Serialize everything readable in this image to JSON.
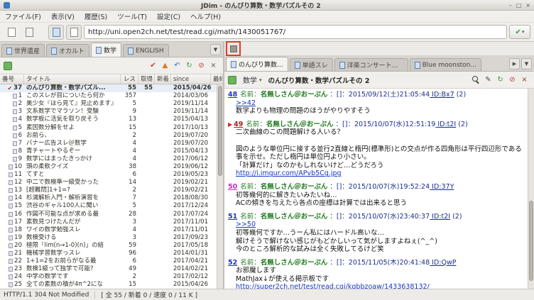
{
  "window": {
    "title": "JDim - のんびり算数・数学パズルその 2",
    "controls": {
      "minimize": "–",
      "maximize": "□",
      "close": "×"
    }
  },
  "icons": {
    "dropdown": "▼",
    "dropdown_small": "▾",
    "tab_next": "▶",
    "check_green": "✔",
    "bookmark": "▶"
  },
  "menubar": [
    "ファイル(F)",
    "表示(V)",
    "履歴(S)",
    "ツール(T)",
    "設定(C)",
    "ヘルプ(H)"
  ],
  "toolbar": {
    "url": "http://uni.open2ch.net/test/read.cgi/math/1430051767/"
  },
  "board_pane": {
    "tabs": [
      {
        "label": "世界遺産",
        "active": false
      },
      {
        "label": "オカルト",
        "active": false
      },
      {
        "label": "数学",
        "active": true
      },
      {
        "label": "ENGLISH",
        "active": false
      }
    ],
    "toolbar_buttons": [
      {
        "name": "check-update-icon",
        "glyph": "✔",
        "color": "#c43c3c"
      },
      {
        "name": "scroll-up-icon",
        "glyph": "▲",
        "color": "#e07820"
      },
      {
        "name": "back-icon",
        "glyph": "↶",
        "color": "#3a6fc4"
      },
      {
        "name": "reload-icon",
        "glyph": "↻",
        "color": "#3a9a3a"
      },
      {
        "name": "stop-icon",
        "glyph": "⊘",
        "color": "#c43c3c"
      },
      {
        "name": "close-icon",
        "glyph": "×",
        "color": "#555555"
      }
    ],
    "columns": [
      "番号",
      "タイトル",
      "レス",
      "取得",
      "新着",
      "since",
      "最終書込"
    ],
    "rows": [
      {
        "check": true,
        "selected": true,
        "num": "37",
        "title": "のんびり算数・数学パズル...",
        "res": "55",
        "got": "55",
        "new": "",
        "since": "2015/04/26"
      },
      {
        "num": "1",
        "title": "このスレが目についたら何か",
        "res": "357",
        "since": "2014/03/06"
      },
      {
        "num": "2",
        "title": "美少女『ほら見て』見止めます』",
        "res": "5",
        "since": "2019/11/14"
      },
      {
        "num": "3",
        "title": "文系数学でマラソン！受験",
        "res": "9",
        "since": "2019/11/14"
      },
      {
        "num": "4",
        "title": "数学板に活気を取り戻そう",
        "res": "13",
        "since": "2015/04/13"
      },
      {
        "num": "5",
        "title": "素因数分解をせよ",
        "res": "15",
        "since": "2017/10/13"
      },
      {
        "num": "6",
        "title": "お前ら、",
        "res": "2",
        "since": "2019/07/20"
      },
      {
        "num": "7",
        "title": "バナー広告スレ＠数学",
        "res": "4",
        "since": "2019/07/20"
      },
      {
        "num": "8",
        "title": "青チャートやるぞー",
        "res": "4",
        "since": "2015/04/13"
      },
      {
        "num": "9",
        "title": "数学にはまったきっかけ",
        "res": "4",
        "since": "2017/06/12"
      },
      {
        "num": "10",
        "title": "頭の柔軟クイズ",
        "res": "38",
        "since": "2019/06/12"
      },
      {
        "num": "11",
        "title": "てすと",
        "res": "6",
        "since": "2019/05/23"
      },
      {
        "num": "12",
        "title": "中二で数検準一級受かった",
        "res": "14",
        "since": "2019/02/21"
      },
      {
        "num": "13",
        "title": "[超難問]1+1=?",
        "res": "2",
        "since": "2019/02/21"
      },
      {
        "num": "14",
        "title": "杉浦解析入門・解析演習を",
        "res": "7",
        "since": "2018/08/30"
      },
      {
        "num": "15",
        "title": "渋谷のギャル100人に聞い",
        "res": "5",
        "since": "2017/12/24"
      },
      {
        "num": "16",
        "title": "作図不可能な点が求める最",
        "res": "28",
        "since": "2017/07/24"
      },
      {
        "num": "17",
        "title": "素数見つけたんだが",
        "res": "3",
        "since": "2017/11/01"
      },
      {
        "num": "18",
        "title": "ワイの数学勉強スレ",
        "res": "4",
        "since": "2017/11/01"
      },
      {
        "num": "19",
        "title": "数検受ける",
        "res": "3",
        "since": "2017/09/23"
      },
      {
        "num": "20",
        "title": "極限「lim(n→1-0)(n)」の結",
        "res": "59",
        "since": "2017/05/18"
      },
      {
        "num": "21",
        "title": "機械学習数学っスレ",
        "res": "96",
        "since": "2014/01/31"
      },
      {
        "num": "22",
        "title": "1+1=2をお前らがなる最",
        "res": "6",
        "since": "2017/04/21"
      },
      {
        "num": "23",
        "title": "数検1級って独学で可能?",
        "res": "49",
        "since": "2014/02/21"
      },
      {
        "num": "24",
        "title": "中学の数学です",
        "res": "2",
        "since": "2017/02/12"
      },
      {
        "num": "25",
        "title": "全ての素数の積が4π^2にな",
        "res": "15",
        "since": "2015/04/26"
      }
    ]
  },
  "thread_pane": {
    "tabs": [
      {
        "label": "のんびり算数...",
        "active": true
      },
      {
        "label": "単語スレ",
        "active": false
      },
      {
        "label": "洋楽コンサートスレ",
        "active": false
      },
      {
        "label": "Blue moonston...",
        "active": false
      }
    ],
    "board_label": "数学",
    "title": "のんびり算数・数学パズルその 2",
    "toolbar_buttons": [
      {
        "name": "search-icon",
        "css": "search"
      },
      {
        "name": "write-icon",
        "glyph": "✎",
        "color": "#444444"
      },
      {
        "name": "reload-icon",
        "glyph": "↻",
        "color": "#3a9a3a"
      },
      {
        "name": "stop-icon",
        "glyph": "⊘",
        "color": "#c43c3c"
      },
      {
        "name": "close-icon",
        "glyph": "×",
        "color": "#a03030"
      }
    ],
    "name_label": "名前：",
    "posts": [
      {
        "num": "48",
        "num_color": "#2233cc",
        "bookmark": false,
        "name": "名無しさん＠おーぷん",
        "meta": " ：[]：2015/09/12(土)21:05:44",
        "id": "ID:Bx7",
        "id_count": "(2)",
        "lines": [
          {
            "text": ">>42",
            "link": true
          },
          {
            "text": "数学よりも物理の問題のほうがやりやすそう",
            "link": false
          }
        ]
      },
      {
        "num": "49",
        "num_color": "#a02020",
        "bookmark": true,
        "name": "名無しさん＠おーぷん",
        "meta": " ：[]：2015/10/07(水)12:51:19",
        "id": "ID:t2I",
        "id_count": "(2)",
        "lines": [
          {
            "text": "二次曲線のこの問題解ける人いる？",
            "link": false
          },
          {
            "text": "",
            "link": false
          },
          {
            "text": "図のような単位円に接する並行2直線と楕円(標準形)との交点が作る四角形は平行四辺形である事を示せ。ただし楕円は単位円より小さい。",
            "link": false
          },
          {
            "text": "「計算だけ」なのかもしれないけど…どうだろう",
            "link": false
          },
          {
            "text": "http://i.imgur.com/APvb5Cg.jpg",
            "link": true
          }
        ]
      },
      {
        "num": "50",
        "num_color": "#c030c0",
        "bookmark": false,
        "name": "名無しさん＠おーぷん",
        "meta": " ：[]：2015/10/07(水)19:52:24",
        "id": "ID:37Y",
        "id_count": "",
        "lines": [
          {
            "text": "初等幾何的に解きたいみたいね…",
            "link": false
          },
          {
            "text": "ACの傾きを与えたら各点の座標は計算では出来ると思う",
            "link": false
          }
        ]
      },
      {
        "num": "51",
        "num_color": "#2233cc",
        "bookmark": false,
        "name": "名無しさん＠おーぷん",
        "meta": " ：[]：2015/10/07(水)23:40:37",
        "id": "ID:t2I",
        "id_count": "(2)",
        "lines": [
          {
            "text": ">>50",
            "link": true
          },
          {
            "text": "初等幾何ですか…うーん私にはハードル高いな…",
            "link": false
          },
          {
            "text": "解けそうで解けない感じがもどかしいって気がしますよねぇ(^_^)",
            "link": false
          },
          {
            "text": "今のところ解析的な試みは全く失敗してるけど笑",
            "link": false
          }
        ]
      },
      {
        "num": "52",
        "num_color": "#2233cc",
        "bookmark": false,
        "name": "名無しさん＠おーぷん",
        "meta": " ：[]：2015/11/05(木)20:41:48",
        "id": "ID:QwP",
        "id_count": "",
        "lines": [
          {
            "text": "お邪魔します",
            "link": false
          },
          {
            "text": "MathJax↓が使える掲示板です",
            "link": false
          },
          {
            "text": "http://super2ch.net/test/read.cgi/kqbbzoaw/1433638132/",
            "link": true
          }
        ]
      }
    ]
  },
  "statusbar": {
    "http": "HTTP/1.1 304 Not Modified",
    "counts": "[ 全 55 / 新着 0 / 速度 0 / 11 K ]"
  }
}
